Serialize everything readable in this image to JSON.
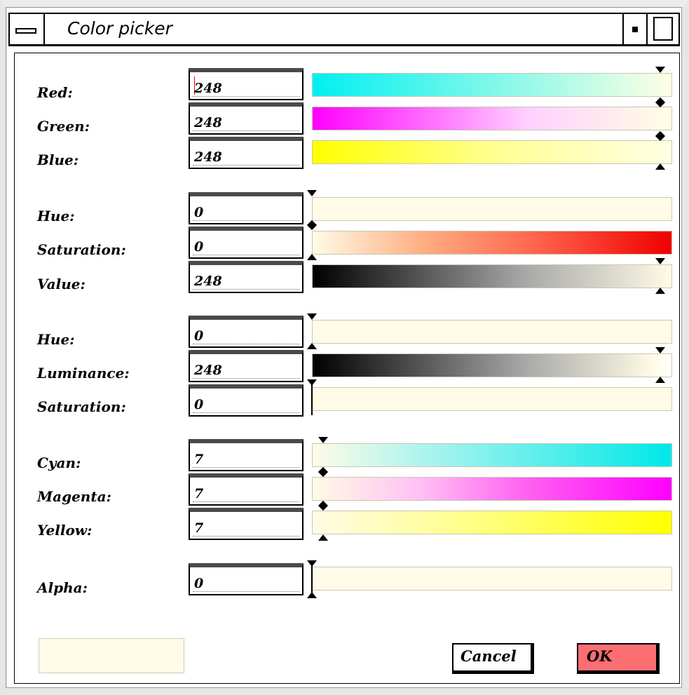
{
  "window": {
    "title": "Color picker"
  },
  "colors": {
    "ok_button": "#fb6e72",
    "preview_swatch": "#fffbe6",
    "field_top_bar": "#4a4a4a"
  },
  "rgb": [
    {
      "label": "Red:",
      "value": "248",
      "gradient": "linear-gradient(90deg,#00f0f0,#ffffe4)"
    },
    {
      "label": "Green:",
      "value": "248",
      "gradient": "linear-gradient(90deg,#ff00ff,#ff66ff 30%,#ffd0ff 60%,#ffffe4)"
    },
    {
      "label": "Blue:",
      "value": "248",
      "gradient": "linear-gradient(90deg,#ffff00,#ffff90 50%,#ffffe4)"
    }
  ],
  "hsv": [
    {
      "label": "Hue:",
      "value": "0",
      "gradient": "linear-gradient(90deg,#fffbe6,#fffbe6)"
    },
    {
      "label": "Saturation:",
      "value": "0",
      "gradient": "linear-gradient(90deg,#fffbe6,#ffb084 30%,#ff6a50 60%,#f00000)"
    },
    {
      "label": "Value:",
      "value": "248",
      "gradient": "linear-gradient(90deg,#000000,#555555 30%,#aaaaaa 60%,#fffbe6)"
    }
  ],
  "hls": [
    {
      "label": "Hue:",
      "value": "0",
      "gradient": "linear-gradient(90deg,#fffbe6,#fffbe6)"
    },
    {
      "label": "Luminance:",
      "value": "248",
      "gradient": "linear-gradient(90deg,#000000,#555555 30%,#aaaaaa 60%,#fffbe6 95%,#ffffff)"
    },
    {
      "label": "Saturation:",
      "value": "0",
      "gradient": "linear-gradient(90deg,#fffbe6,#fffbe6)"
    }
  ],
  "cmy": [
    {
      "label": "Cyan:",
      "value": "7",
      "gradient": "linear-gradient(90deg,#fffbe6,#b0f4ee 30%,#00e8e8)"
    },
    {
      "label": "Magenta:",
      "value": "7",
      "gradient": "linear-gradient(90deg,#fffbe6,#ffc0f4 30%,#ff60f0 60%,#ff00ff)"
    },
    {
      "label": "Yellow:",
      "value": "7",
      "gradient": "linear-gradient(90deg,#fffbe6,#ffff90 40%,#ffff00)"
    }
  ],
  "alpha": {
    "label": "Alpha:",
    "value": "0"
  },
  "buttons": {
    "cancel": "Cancel",
    "ok": "OK"
  }
}
